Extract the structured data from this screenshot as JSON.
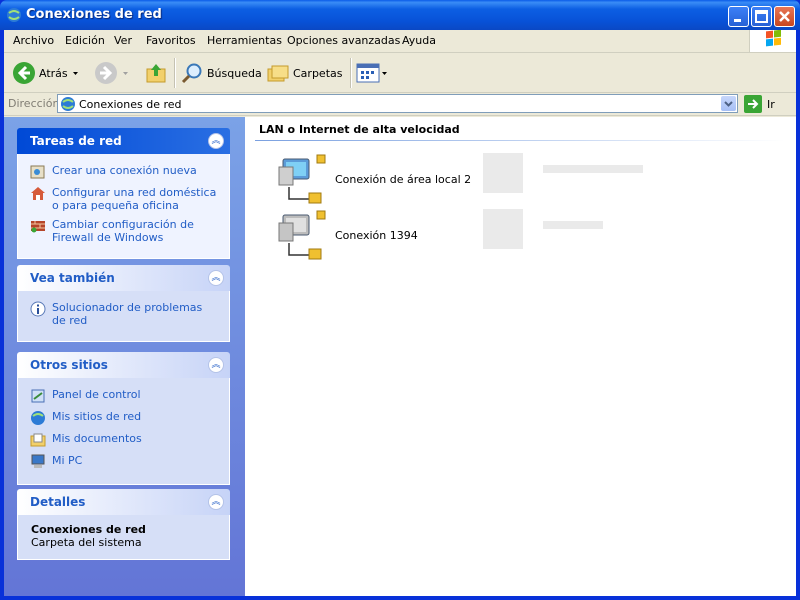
{
  "window": {
    "title": "Conexiones de red"
  },
  "menu": [
    "Archivo",
    "Edición",
    "Ver",
    "Favoritos",
    "Herramientas",
    "Opciones avanzadas",
    "Ayuda"
  ],
  "toolbar": {
    "back": "Atrás",
    "search": "Búsqueda",
    "folders": "Carpetas"
  },
  "address": {
    "label": "Dirección",
    "value": "Conexiones de red",
    "go": "Ir"
  },
  "sidebar": {
    "network_tasks": {
      "title": "Tareas de red",
      "items": [
        "Crear una conexión nueva",
        "Configurar una red doméstica o para pequeña oficina",
        "Cambiar configuración de Firewall de Windows"
      ]
    },
    "see_also": {
      "title": "Vea también",
      "items": [
        "Solucionador de problemas de red"
      ]
    },
    "other_places": {
      "title": "Otros sitios",
      "items": [
        "Panel de control",
        "Mis sitios de red",
        "Mis documentos",
        "Mi PC"
      ]
    },
    "details": {
      "title": "Detalles",
      "name": "Conexiones de red",
      "type": "Carpeta del sistema"
    }
  },
  "content": {
    "group_title": "LAN o Internet de alta velocidad",
    "connections": [
      "Conexión de área local 2",
      "Conexión 1394"
    ]
  },
  "colors": {
    "titlebar": "#0852d8",
    "sidebar_top": "#7ba2e7",
    "sidebar_bottom": "#6375d6",
    "link": "#215dc6"
  }
}
